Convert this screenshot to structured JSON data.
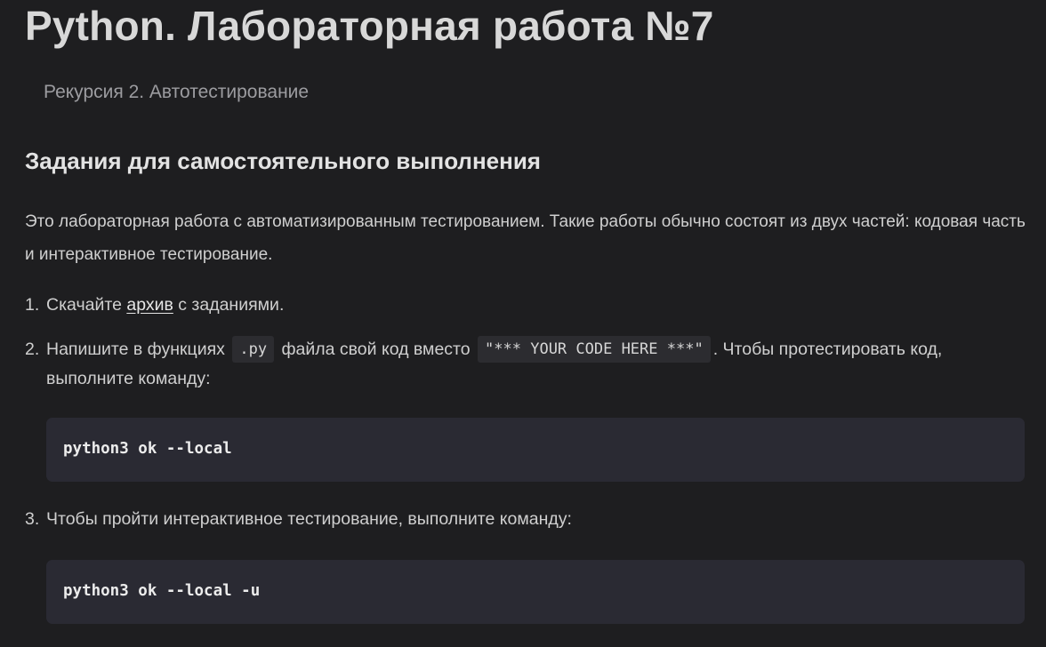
{
  "page": {
    "title": "Python. Лабораторная работа №7",
    "subtitle": "Рекурсия 2. Автотестирование"
  },
  "section": {
    "heading": "Задания для самостоятельного выполнения",
    "intro": "Это лабораторная работа с автоматизированным тестированием. Такие работы обычно состоят из двух частей: кодовая часть и интерактивное тестирование."
  },
  "steps": [
    {
      "number": "1.",
      "before": "Скачайте ",
      "link": "архив",
      "after": " с заданиями."
    },
    {
      "number": "2.",
      "before": "Напишите в функциях",
      "code_ext": ".py",
      "middle": "файла свой код вместо",
      "code_placeholder": "\"*** YOUR CODE HERE ***\"",
      "after": ". Чтобы протестировать код,",
      "continuation": "выполните команду:",
      "command": "python3 ok --local"
    },
    {
      "number": "3.",
      "text": "Чтобы пройти интерактивное тестирование, выполните команду:",
      "command": "python3 ok --local -u"
    }
  ]
}
